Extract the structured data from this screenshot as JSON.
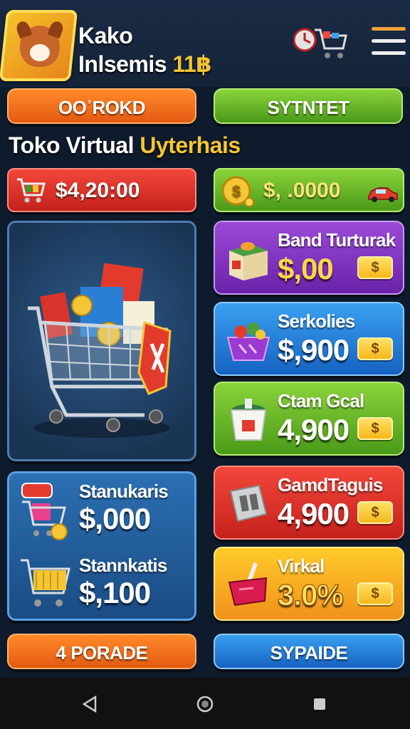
{
  "player": {
    "name_line1": "Kako",
    "name_line2": "Inlsemis",
    "level": "11฿"
  },
  "icons": {
    "avatar": "dog-avatar-icon",
    "cart": "shopping-cart-icon",
    "menu": "hamburger-menu-icon",
    "coin": "coin-icon",
    "car": "car-icon"
  },
  "buttons": {
    "top_left": "OOʾROKD",
    "top_right": "SYTNTET",
    "bottom_left": "4 PORADE",
    "bottom_right": "SYPAIDE"
  },
  "store": {
    "title_main": "Toko Virtual",
    "title_accent": "Uyterhais"
  },
  "balances": {
    "cash": "$4,20:00",
    "coins": "$, .0000"
  },
  "shop_items": [
    {
      "name": "Band Turturak",
      "price": "$,00",
      "buy_label": "$",
      "color": "#7b33c0"
    },
    {
      "name": "Serkolies",
      "price": "$,900",
      "buy_label": "$",
      "color": "#2a7fd4"
    },
    {
      "name": "Ctam Gcal",
      "price": "4,900",
      "buy_label": "$",
      "color": "#5aae28"
    },
    {
      "name": "GamdTaguis",
      "price": "4,900",
      "buy_label": "$",
      "color": "#d5302a"
    },
    {
      "name": "Virkal",
      "price": "3.0%",
      "buy_label": "$",
      "color": "#f5a91e"
    }
  ],
  "stats": [
    {
      "name": "Stanukaris",
      "value": "$,000"
    },
    {
      "name": "Stannkatis",
      "value": "$,100"
    }
  ],
  "colors": {
    "accent_yellow": "#f4c534",
    "background": "#0e1b2c"
  }
}
